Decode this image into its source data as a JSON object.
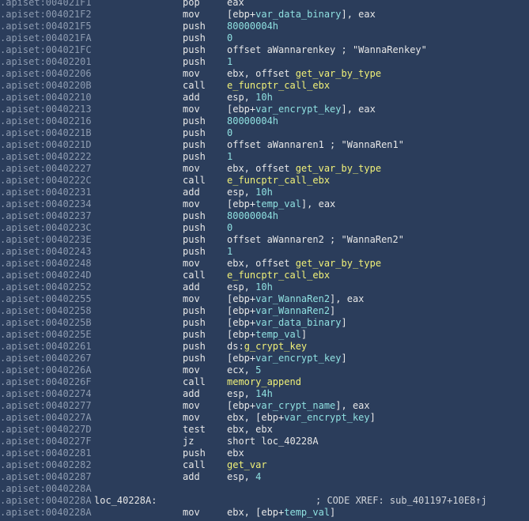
{
  "colors": {
    "background": "#2b3d5b",
    "address": "#8d9bb0",
    "text": "#e7e7e7",
    "number_or_var": "#8fe0e0",
    "function_name": "#f0f078"
  },
  "rows": [
    {
      "addr": ".apiset:004021F1",
      "label": "",
      "mnem": "pop",
      "ops": [
        {
          "t": "eax",
          "c": "txt"
        }
      ]
    },
    {
      "addr": ".apiset:004021F2",
      "label": "",
      "mnem": "mov",
      "ops": [
        {
          "t": "[ebp+",
          "c": "txt"
        },
        {
          "t": "var_data_binary",
          "c": "var"
        },
        {
          "t": "], eax",
          "c": "txt"
        }
      ]
    },
    {
      "addr": ".apiset:004021F5",
      "label": "",
      "mnem": "push",
      "ops": [
        {
          "t": "80000004h",
          "c": "num"
        }
      ]
    },
    {
      "addr": ".apiset:004021FA",
      "label": "",
      "mnem": "push",
      "ops": [
        {
          "t": "0",
          "c": "num"
        }
      ]
    },
    {
      "addr": ".apiset:004021FC",
      "label": "",
      "mnem": "push",
      "ops": [
        {
          "t": "offset aWannarenkey ; \"WannaRenkey\"",
          "c": "txt"
        }
      ]
    },
    {
      "addr": ".apiset:00402201",
      "label": "",
      "mnem": "push",
      "ops": [
        {
          "t": "1",
          "c": "num"
        }
      ]
    },
    {
      "addr": ".apiset:00402206",
      "label": "",
      "mnem": "mov",
      "ops": [
        {
          "t": "ebx, offset ",
          "c": "txt"
        },
        {
          "t": "get_var_by_type",
          "c": "fn"
        }
      ]
    },
    {
      "addr": ".apiset:0040220B",
      "label": "",
      "mnem": "call",
      "ops": [
        {
          "t": "e_funcptr_call_ebx",
          "c": "fn"
        }
      ]
    },
    {
      "addr": ".apiset:00402210",
      "label": "",
      "mnem": "add",
      "ops": [
        {
          "t": "esp, ",
          "c": "txt"
        },
        {
          "t": "10h",
          "c": "num"
        }
      ]
    },
    {
      "addr": ".apiset:00402213",
      "label": "",
      "mnem": "mov",
      "ops": [
        {
          "t": "[ebp+",
          "c": "txt"
        },
        {
          "t": "var_encrypt_key",
          "c": "var"
        },
        {
          "t": "], eax",
          "c": "txt"
        }
      ]
    },
    {
      "addr": ".apiset:00402216",
      "label": "",
      "mnem": "push",
      "ops": [
        {
          "t": "80000004h",
          "c": "num"
        }
      ]
    },
    {
      "addr": ".apiset:0040221B",
      "label": "",
      "mnem": "push",
      "ops": [
        {
          "t": "0",
          "c": "num"
        }
      ]
    },
    {
      "addr": ".apiset:0040221D",
      "label": "",
      "mnem": "push",
      "ops": [
        {
          "t": "offset aWannaren1 ; \"WannaRen1\"",
          "c": "txt"
        }
      ]
    },
    {
      "addr": ".apiset:00402222",
      "label": "",
      "mnem": "push",
      "ops": [
        {
          "t": "1",
          "c": "num"
        }
      ]
    },
    {
      "addr": ".apiset:00402227",
      "label": "",
      "mnem": "mov",
      "ops": [
        {
          "t": "ebx, offset ",
          "c": "txt"
        },
        {
          "t": "get_var_by_type",
          "c": "fn"
        }
      ]
    },
    {
      "addr": ".apiset:0040222C",
      "label": "",
      "mnem": "call",
      "ops": [
        {
          "t": "e_funcptr_call_ebx",
          "c": "fn"
        }
      ]
    },
    {
      "addr": ".apiset:00402231",
      "label": "",
      "mnem": "add",
      "ops": [
        {
          "t": "esp, ",
          "c": "txt"
        },
        {
          "t": "10h",
          "c": "num"
        }
      ]
    },
    {
      "addr": ".apiset:00402234",
      "label": "",
      "mnem": "mov",
      "ops": [
        {
          "t": "[ebp+",
          "c": "txt"
        },
        {
          "t": "temp_val",
          "c": "var"
        },
        {
          "t": "], eax",
          "c": "txt"
        }
      ]
    },
    {
      "addr": ".apiset:00402237",
      "label": "",
      "mnem": "push",
      "ops": [
        {
          "t": "80000004h",
          "c": "num"
        }
      ]
    },
    {
      "addr": ".apiset:0040223C",
      "label": "",
      "mnem": "push",
      "ops": [
        {
          "t": "0",
          "c": "num"
        }
      ]
    },
    {
      "addr": ".apiset:0040223E",
      "label": "",
      "mnem": "push",
      "ops": [
        {
          "t": "offset aWannaren2 ; \"WannaRen2\"",
          "c": "txt"
        }
      ]
    },
    {
      "addr": ".apiset:00402243",
      "label": "",
      "mnem": "push",
      "ops": [
        {
          "t": "1",
          "c": "num"
        }
      ]
    },
    {
      "addr": ".apiset:00402248",
      "label": "",
      "mnem": "mov",
      "ops": [
        {
          "t": "ebx, offset ",
          "c": "txt"
        },
        {
          "t": "get_var_by_type",
          "c": "fn"
        }
      ]
    },
    {
      "addr": ".apiset:0040224D",
      "label": "",
      "mnem": "call",
      "ops": [
        {
          "t": "e_funcptr_call_ebx",
          "c": "fn"
        }
      ]
    },
    {
      "addr": ".apiset:00402252",
      "label": "",
      "mnem": "add",
      "ops": [
        {
          "t": "esp, ",
          "c": "txt"
        },
        {
          "t": "10h",
          "c": "num"
        }
      ]
    },
    {
      "addr": ".apiset:00402255",
      "label": "",
      "mnem": "mov",
      "ops": [
        {
          "t": "[ebp+",
          "c": "txt"
        },
        {
          "t": "var_WannaRen2",
          "c": "var"
        },
        {
          "t": "], eax",
          "c": "txt"
        }
      ]
    },
    {
      "addr": ".apiset:00402258",
      "label": "",
      "mnem": "push",
      "ops": [
        {
          "t": "[ebp+",
          "c": "txt"
        },
        {
          "t": "var_WannaRen2",
          "c": "var"
        },
        {
          "t": "]",
          "c": "txt"
        }
      ]
    },
    {
      "addr": ".apiset:0040225B",
      "label": "",
      "mnem": "push",
      "ops": [
        {
          "t": "[ebp+",
          "c": "txt"
        },
        {
          "t": "var_data_binary",
          "c": "var"
        },
        {
          "t": "]",
          "c": "txt"
        }
      ]
    },
    {
      "addr": ".apiset:0040225E",
      "label": "",
      "mnem": "push",
      "ops": [
        {
          "t": "[ebp+",
          "c": "txt"
        },
        {
          "t": "temp_val",
          "c": "var"
        },
        {
          "t": "]",
          "c": "txt"
        }
      ]
    },
    {
      "addr": ".apiset:00402261",
      "label": "",
      "mnem": "push",
      "ops": [
        {
          "t": "ds:",
          "c": "txt"
        },
        {
          "t": "g_crypt_key",
          "c": "fn"
        }
      ]
    },
    {
      "addr": ".apiset:00402267",
      "label": "",
      "mnem": "push",
      "ops": [
        {
          "t": "[ebp+",
          "c": "txt"
        },
        {
          "t": "var_encrypt_key",
          "c": "var"
        },
        {
          "t": "]",
          "c": "txt"
        }
      ]
    },
    {
      "addr": ".apiset:0040226A",
      "label": "",
      "mnem": "mov",
      "ops": [
        {
          "t": "ecx, ",
          "c": "txt"
        },
        {
          "t": "5",
          "c": "num"
        }
      ]
    },
    {
      "addr": ".apiset:0040226F",
      "label": "",
      "mnem": "call",
      "ops": [
        {
          "t": "memory_append",
          "c": "fn"
        }
      ]
    },
    {
      "addr": ".apiset:00402274",
      "label": "",
      "mnem": "add",
      "ops": [
        {
          "t": "esp, ",
          "c": "txt"
        },
        {
          "t": "14h",
          "c": "num"
        }
      ]
    },
    {
      "addr": ".apiset:00402277",
      "label": "",
      "mnem": "mov",
      "ops": [
        {
          "t": "[ebp+",
          "c": "txt"
        },
        {
          "t": "var_crypt_name",
          "c": "var"
        },
        {
          "t": "], eax",
          "c": "txt"
        }
      ]
    },
    {
      "addr": ".apiset:0040227A",
      "label": "",
      "mnem": "mov",
      "ops": [
        {
          "t": "ebx, [ebp+",
          "c": "txt"
        },
        {
          "t": "var_encrypt_key",
          "c": "var"
        },
        {
          "t": "]",
          "c": "txt"
        }
      ]
    },
    {
      "addr": ".apiset:0040227D",
      "label": "",
      "mnem": "test",
      "ops": [
        {
          "t": "ebx, ebx",
          "c": "txt"
        }
      ]
    },
    {
      "addr": ".apiset:0040227F",
      "label": "",
      "mnem": "jz",
      "ops": [
        {
          "t": "short loc_40228A",
          "c": "txt"
        }
      ]
    },
    {
      "addr": ".apiset:00402281",
      "label": "",
      "mnem": "push",
      "ops": [
        {
          "t": "ebx",
          "c": "txt"
        }
      ]
    },
    {
      "addr": ".apiset:00402282",
      "label": "",
      "mnem": "call",
      "ops": [
        {
          "t": "get_var",
          "c": "fn"
        }
      ]
    },
    {
      "addr": ".apiset:00402287",
      "label": "",
      "mnem": "add",
      "ops": [
        {
          "t": "esp, ",
          "c": "txt"
        },
        {
          "t": "4",
          "c": "num"
        }
      ]
    },
    {
      "addr": ".apiset:0040228A",
      "label": "",
      "mnem": "",
      "ops": []
    },
    {
      "addr": ".apiset:0040228A",
      "label": "loc_40228A:",
      "mnem": "",
      "ops": [],
      "comment": "; CODE XREF: sub_401197+10E8↑j"
    },
    {
      "addr": ".apiset:0040228A",
      "label": "",
      "mnem": "mov",
      "ops": [
        {
          "t": "ebx, [ebp+",
          "c": "txt"
        },
        {
          "t": "temp_val",
          "c": "var"
        },
        {
          "t": "]",
          "c": "txt"
        }
      ]
    }
  ]
}
